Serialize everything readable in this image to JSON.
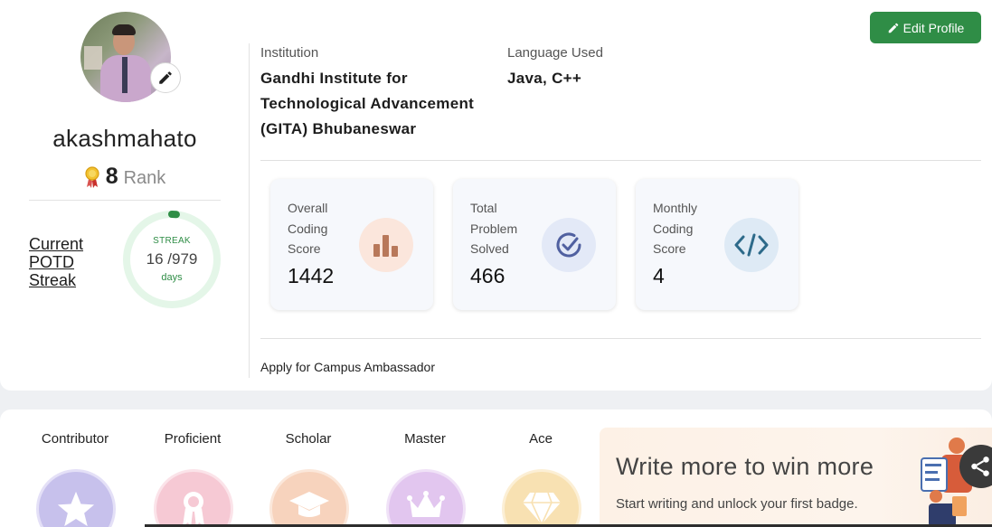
{
  "profile": {
    "username": "akashmahato",
    "rank_value": "8",
    "rank_label": "Rank",
    "potd_label": "Current POTD Streak",
    "streak": {
      "label": "STREAK",
      "current": "16",
      "total": "/979",
      "unit": "days",
      "fraction": 0.016
    },
    "edit_profile_label": "Edit Profile"
  },
  "info": {
    "institution_label": "Institution",
    "institution_value": "Gandhi Institute for Technological Advancement (GITA) Bhubaneswar",
    "language_label": "Language Used",
    "language_value": "Java, C++"
  },
  "stats": [
    {
      "label": "Overall Coding Score",
      "value": "1442",
      "icon": "bar-chart-icon",
      "icon_bg": "#fbe6dc",
      "icon_color": "#b8785a"
    },
    {
      "label": "Total Problem Solved",
      "value": "466",
      "icon": "check-circle-icon",
      "icon_bg": "#e3e9f7",
      "icon_color": "#5060a0"
    },
    {
      "label": "Monthly Coding Score",
      "value": "4",
      "icon": "code-icon",
      "icon_bg": "#deeaf5",
      "icon_color": "#2d6a8a"
    }
  ],
  "ambassador_link": "Apply for Campus Ambassador",
  "badges": [
    {
      "name": "Contributor",
      "icon": "star-icon",
      "color": "#c7c1ec"
    },
    {
      "name": "Proficient",
      "icon": "ribbon-icon",
      "color": "#f6c9d4"
    },
    {
      "name": "Scholar",
      "icon": "graduation-cap-icon",
      "color": "#f7d3bd"
    },
    {
      "name": "Master",
      "icon": "crown-icon",
      "color": "#e2c6ef"
    },
    {
      "name": "Ace",
      "icon": "diamond-icon",
      "color": "#f8e1b2"
    }
  ],
  "promo": {
    "title": "Write more to win more",
    "subtitle": "Start writing and unlock your first badge."
  },
  "colors": {
    "accent": "#2f8d46"
  }
}
